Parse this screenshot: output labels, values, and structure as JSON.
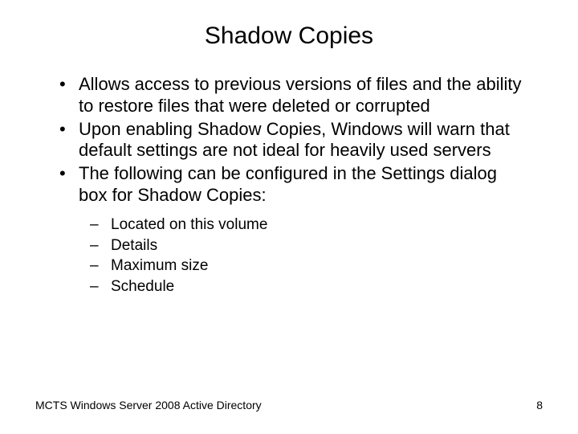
{
  "title": "Shadow Copies",
  "bullets": [
    "Allows access to previous versions of files and the ability to restore files that were deleted or corrupted",
    "Upon enabling Shadow Copies, Windows will warn that default settings are not ideal for heavily used servers",
    "The following can be configured in the Settings dialog box for Shadow Copies:"
  ],
  "sub_bullets": [
    "Located on this volume",
    "Details",
    "Maximum size",
    "Schedule"
  ],
  "footer": {
    "left": "MCTS Windows Server 2008 Active Directory",
    "right": "8"
  }
}
